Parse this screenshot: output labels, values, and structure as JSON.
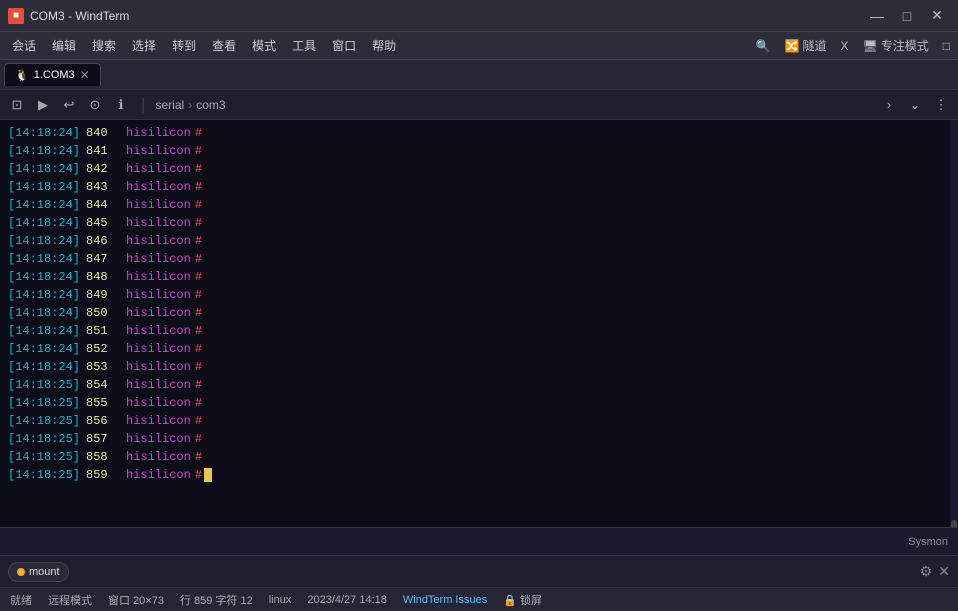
{
  "titleBar": {
    "icon": "■",
    "title": "COM3 - WindTerm",
    "minimize": "—",
    "maximize": "□",
    "close": "✕"
  },
  "menuBar": {
    "items": [
      "会话",
      "编辑",
      "搜索",
      "选择",
      "转到",
      "查看",
      "模式",
      "工具",
      "窗口",
      "帮助"
    ],
    "rightItems": [
      "🔍",
      "隧道",
      "X",
      "专注模式",
      "□"
    ]
  },
  "tab": {
    "icon": "🐧",
    "label": "1.COM3",
    "close": "✕"
  },
  "toolbar": {
    "buttons": [
      "⊡",
      "▶",
      "↩",
      "⊙"
    ],
    "info": "ℹ",
    "separator": "│",
    "breadcrumb": [
      "serial",
      "com3"
    ],
    "rightButtons": [
      "›",
      "⌄",
      "⋮"
    ]
  },
  "terminal": {
    "lines": [
      {
        "time": "[14:18:24]",
        "num": "840",
        "host": "hisilicon",
        "hash": "#"
      },
      {
        "time": "[14:18:24]",
        "num": "841",
        "host": "hisilicon",
        "hash": "#"
      },
      {
        "time": "[14:18:24]",
        "num": "842",
        "host": "hisilicon",
        "hash": "#"
      },
      {
        "time": "[14:18:24]",
        "num": "843",
        "host": "hisilicon",
        "hash": "#"
      },
      {
        "time": "[14:18:24]",
        "num": "844",
        "host": "hisilicon",
        "hash": "#"
      },
      {
        "time": "[14:18:24]",
        "num": "845",
        "host": "hisilicon",
        "hash": "#"
      },
      {
        "time": "[14:18:24]",
        "num": "846",
        "host": "hisilicon",
        "hash": "#"
      },
      {
        "time": "[14:18:24]",
        "num": "847",
        "host": "hisilicon",
        "hash": "#"
      },
      {
        "time": "[14:18:24]",
        "num": "848",
        "host": "hisilicon",
        "hash": "#"
      },
      {
        "time": "[14:18:24]",
        "num": "849",
        "host": "hisilicon",
        "hash": "#"
      },
      {
        "time": "[14:18:24]",
        "num": "850",
        "host": "hisilicon",
        "hash": "#"
      },
      {
        "time": "[14:18:24]",
        "num": "851",
        "host": "hisilicon",
        "hash": "#"
      },
      {
        "time": "[14:18:24]",
        "num": "852",
        "host": "hisilicon",
        "hash": "#"
      },
      {
        "time": "[14:18:24]",
        "num": "853",
        "host": "hisilicon",
        "hash": "#"
      },
      {
        "time": "[14:18:25]",
        "num": "854",
        "host": "hisilicon",
        "hash": "#"
      },
      {
        "time": "[14:18:25]",
        "num": "855",
        "host": "hisilicon",
        "hash": "#"
      },
      {
        "time": "[14:18:25]",
        "num": "856",
        "host": "hisilicon",
        "hash": "#"
      },
      {
        "time": "[14:18:25]",
        "num": "857",
        "host": "hisilicon",
        "hash": "#"
      },
      {
        "time": "[14:18:25]",
        "num": "858",
        "host": "hisilicon",
        "hash": "#"
      },
      {
        "time": "[14:18:25]",
        "num": "859",
        "host": "hisilicon",
        "hash": "#",
        "cursor": true
      }
    ]
  },
  "sysmon": {
    "label": "Sysmon"
  },
  "taskbar": {
    "task": {
      "label": "mount"
    },
    "gear": "⚙",
    "close": "✕"
  },
  "statusBar": {
    "ready": "就绪",
    "mode": "远程模式",
    "window": "窗口 20×73",
    "row": "行 859 字符 12",
    "os": "linux",
    "datetime": "2023/4/27  14:18",
    "link": "WindTerm Issues",
    "lock": "🔒 锁屏"
  }
}
